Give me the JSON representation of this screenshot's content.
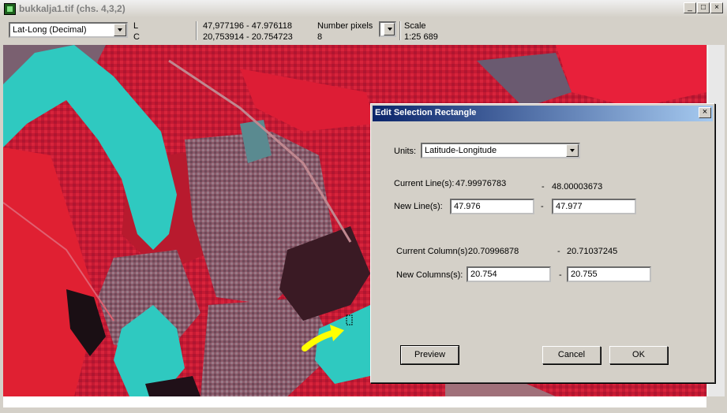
{
  "window": {
    "title": "bukkalja1.tif (chs. 4,3,2)"
  },
  "toolbar": {
    "coord_mode": "Lat-Long (Decimal)",
    "line_label": "L",
    "column_label": "C",
    "line_range": "47,977196 - 47.976118",
    "column_range": "20,753914 - 20.754723",
    "num_pixels_label": "Number pixels",
    "num_pixels_value": "8",
    "scale_label": "Scale",
    "scale_value": "1:25 689"
  },
  "dialog": {
    "title": "Edit Selection Rectangle",
    "units_label": "Units:",
    "units_value": "Latitude-Longitude",
    "current_lines_label": "Current Line(s):",
    "current_line_from": "47.99976783",
    "dash": "-",
    "current_line_to": "48.00003673",
    "new_lines_label": "New Line(s):",
    "new_line_from": "47.976",
    "new_line_to": "47.977",
    "current_columns_label": "Current Column(s):",
    "current_column_from": "20.70996878",
    "current_column_to": "20.71037245",
    "new_columns_label": "New Columns(s):",
    "new_column_from": "20.754",
    "new_column_to": "20.755",
    "preview_label": "Preview",
    "cancel_label": "Cancel",
    "ok_label": "OK"
  },
  "colors": {
    "image_red": "#c41a33",
    "image_cyan": "#2fc9c0",
    "arrow_yellow": "#ffff00",
    "dialog_title_start": "#0a246a"
  }
}
